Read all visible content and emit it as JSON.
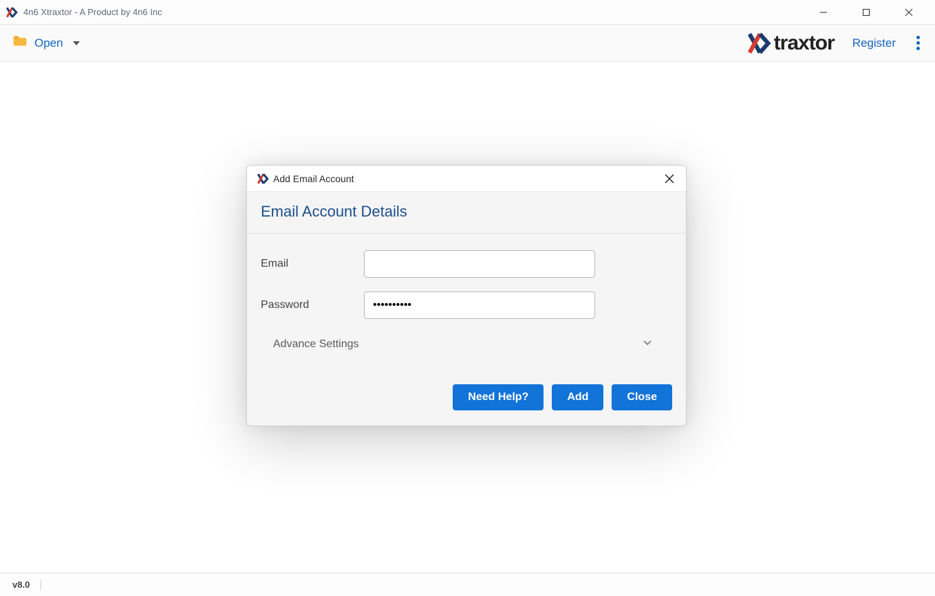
{
  "window": {
    "title": "4n6 Xtraxtor - A Product by 4n6 Inc"
  },
  "toolbar": {
    "open_label": "Open",
    "brand_text": "traxtor",
    "register_label": "Register"
  },
  "dialog": {
    "title": "Add Email Account",
    "heading": "Email Account Details",
    "email_label": "Email",
    "email_value": "",
    "password_label": "Password",
    "password_value": "••••••••••",
    "advance_label": "Advance Settings",
    "buttons": {
      "help": "Need Help?",
      "add": "Add",
      "close": "Close"
    }
  },
  "statusbar": {
    "version": "v8.0"
  }
}
